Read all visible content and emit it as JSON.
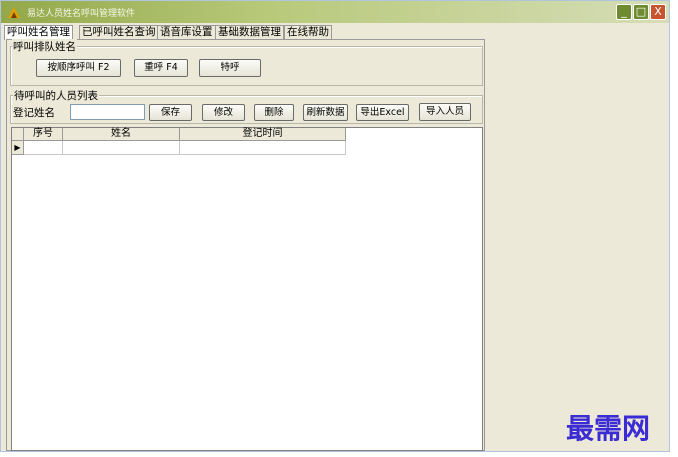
{
  "window": {
    "title": "易达人员姓名呼叫管理软件",
    "controls": {
      "minimize": "_",
      "maximize": "□",
      "close": "X"
    }
  },
  "tabs": [
    {
      "label": "呼叫姓名管理",
      "active": true
    },
    {
      "label": "已呼叫姓名查询",
      "active": false
    },
    {
      "label": "语音库设置",
      "active": false
    },
    {
      "label": "基础数据管理",
      "active": false
    },
    {
      "label": "在线帮助",
      "active": false
    }
  ],
  "queue_group": {
    "title": "呼叫排队姓名",
    "buttons": {
      "sequential": "按顺序呼叫 F2",
      "recall": "重呼 F4",
      "special": "特呼"
    }
  },
  "waiting_group": {
    "title": "待呼叫的人员列表",
    "name_label": "登记姓名",
    "name_value": "",
    "buttons": {
      "save": "保存",
      "edit": "修改",
      "delete": "删除",
      "refresh": "刷新数据",
      "export": "导出Excel",
      "import": "导入人员"
    }
  },
  "grid": {
    "row_indicator": "▶",
    "columns": [
      "序号",
      "姓名",
      "登记时间"
    ]
  },
  "watermark": "最需网",
  "colors": {
    "titlebar": "#93a84a",
    "close_button": "#c8532f",
    "watermark": "#3b2bd4"
  }
}
